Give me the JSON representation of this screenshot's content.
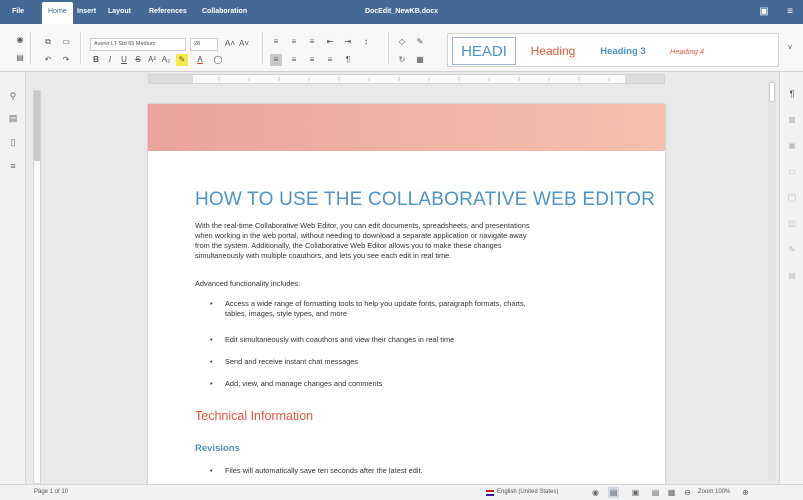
{
  "menu": {
    "tabs": [
      {
        "label": "File"
      },
      {
        "label": "Home"
      },
      {
        "label": "Insert"
      },
      {
        "label": "Layout"
      },
      {
        "label": "References"
      },
      {
        "label": "Collaboration"
      }
    ],
    "document_title": "DocEdit_NewKB.docx"
  },
  "toolbar": {
    "font_name": "Avenir LT Std 65 Medium",
    "font_size": "28",
    "styles": [
      {
        "label": "HEADI",
        "color": "#4f94c4"
      },
      {
        "label": "Heading",
        "color": "#e0583c"
      },
      {
        "label": "Heading 3",
        "color": "#4f94c4"
      },
      {
        "label": "Heading 4",
        "color": "#e0583c"
      }
    ]
  },
  "document": {
    "title": "HOW TO USE THE COLLABORATIVE WEB EDITOR",
    "intro_lines": [
      "With the real-time Collaborative Web Editor, you can edit documents, spreadsheets, and presentations",
      "when working in the web portal, without needing to download a separate application or navigate away",
      "from the system. Additionally, the Collaborative Web Editor allows you to make these changes",
      "simultaneously with multiple coauthors, and lets you see each edit in real time."
    ],
    "features_intro": "Advanced functionality includes:",
    "bullets": [
      {
        "lines": [
          "Access a wide range of formatting tools to help you update fonts, paragraph formats, charts,",
          "tables, images, style types, and more"
        ]
      },
      {
        "lines": [
          "Edit simultaneously with coauthors and view their changes in real time"
        ]
      },
      {
        "lines": [
          "Send and receive instant chat messages"
        ]
      },
      {
        "lines": [
          "Add, view, and manage changes and comments"
        ]
      }
    ],
    "section_heading": "Technical Information",
    "subsection_heading": "Revisions",
    "revision_bullet": "Files will automatically save ten seconds after the latest edit."
  },
  "status": {
    "page_info": "Page 1 of 10",
    "language": "English (United States)",
    "zoom": "Zoom 100%"
  },
  "colors": {
    "accent": "#446995",
    "heading_blue": "#4f94c4",
    "heading_red": "#e0583c"
  }
}
